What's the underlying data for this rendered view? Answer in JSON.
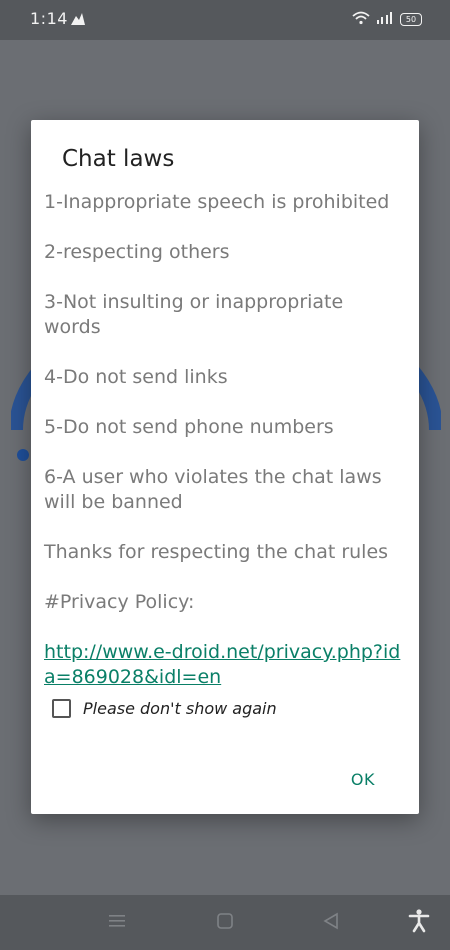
{
  "status_bar": {
    "time": "1:14",
    "battery": "50"
  },
  "dialog": {
    "title": "Chat laws",
    "rules": [
      "1-Inappropriate speech is prohibited",
      "2-respecting others",
      "3-Not insulting or inappropriate words",
      "4-Do not send links",
      "5-Do not send phone numbers",
      "6-A user who violates the chat laws will be banned",
      "Thanks for respecting the chat rules",
      "#Privacy Policy:"
    ],
    "privacy_link": "http://www.e-droid.net/privacy.php?ida=869028&idl=en",
    "checkbox_label": "Please don't show again",
    "ok_label": "OK"
  },
  "colors": {
    "accent": "#0a7f67",
    "scrim": "#6b6e73",
    "status_bar": "#55585c"
  },
  "icons": {
    "status_left": "notification-icon",
    "wifi": "wifi-icon",
    "signal": "signal-icon",
    "nav_menu": "menu-icon",
    "nav_home": "home-icon",
    "nav_back": "back-icon",
    "nav_accessibility": "accessibility-icon"
  }
}
